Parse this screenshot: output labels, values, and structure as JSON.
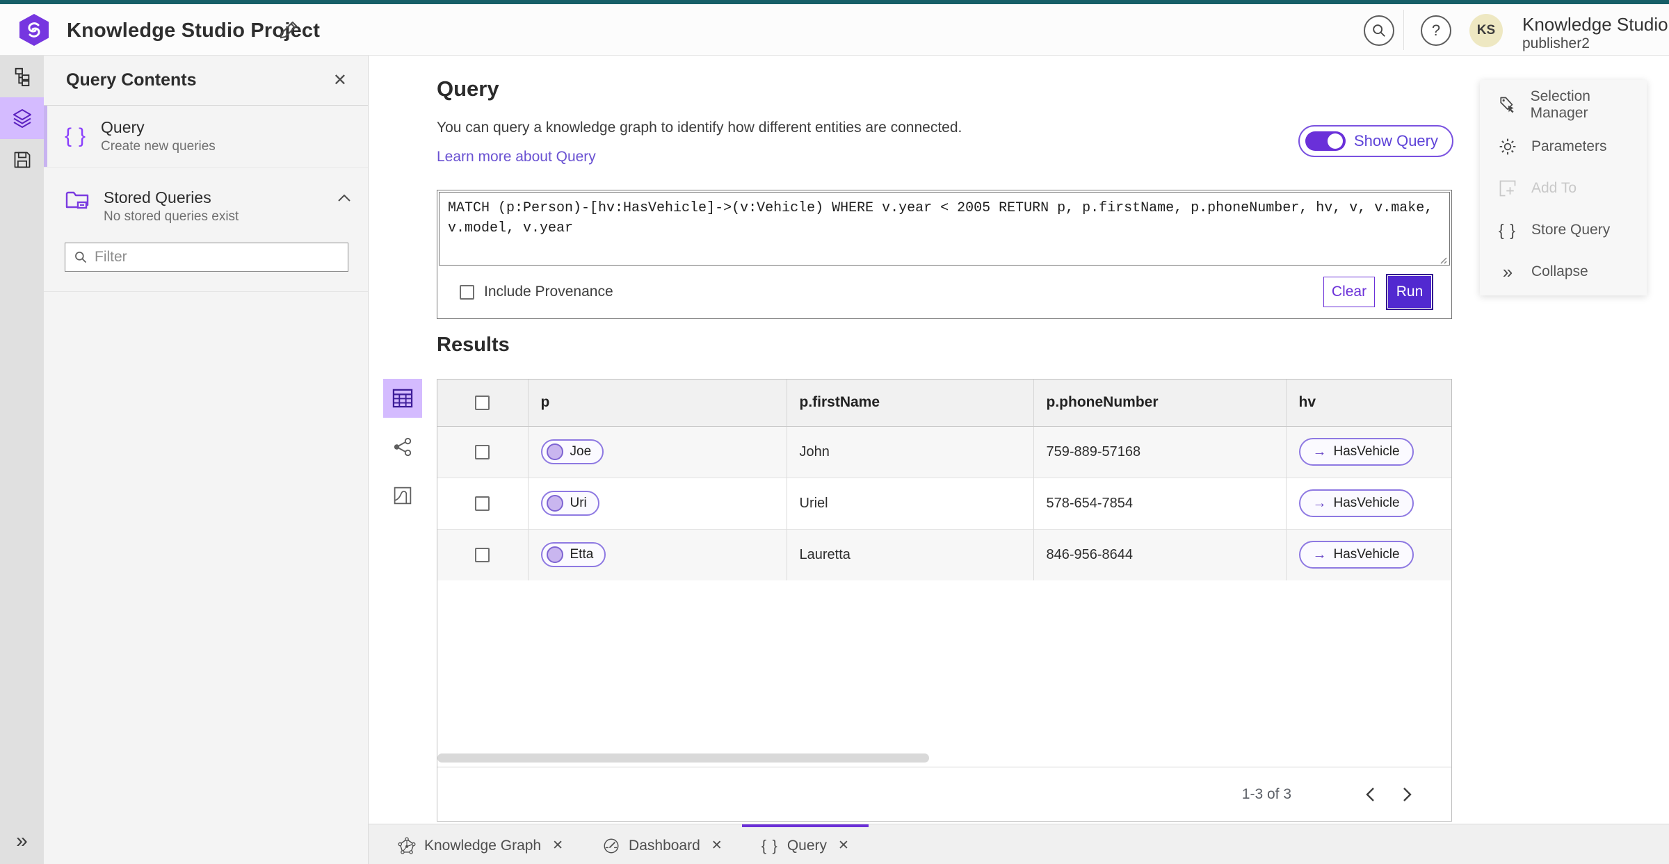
{
  "colors": {
    "top_accent_teal": "#175f68",
    "accent_purple": "#6929c4",
    "selected_lavender": "#d4bbff",
    "run_button_purple": "#5229d0",
    "avatar_bg": "#eee8c2"
  },
  "header": {
    "app_title": "Knowledge Studio Project",
    "user_initials": "KS",
    "user_org": "Knowledge Studio",
    "user_name": "publisher2"
  },
  "left_panel": {
    "title": "Query Contents",
    "query_item": {
      "title": "Query",
      "subtitle": "Create new queries"
    },
    "stored_queries": {
      "title": "Stored Queries",
      "subtitle": "No stored queries exist"
    },
    "filter_placeholder": "Filter"
  },
  "query_section": {
    "title": "Query",
    "description": "You can query a knowledge graph to identify how different entities are connected.",
    "learn_link": "Learn more about Query",
    "show_query_label": "Show Query",
    "query_text": "MATCH (p:Person)-[hv:HasVehicle]->(v:Vehicle) WHERE v.year < 2005 RETURN p, p.firstName, p.phoneNumber, hv, v, v.make, v.model, v.year",
    "include_provenance_label": "Include Provenance",
    "clear_label": "Clear",
    "run_label": "Run"
  },
  "actions_panel": {
    "items": [
      {
        "label": "Selection Manager"
      },
      {
        "label": "Parameters"
      },
      {
        "label": "Add To"
      },
      {
        "label": "Store Query"
      },
      {
        "label": "Collapse"
      }
    ]
  },
  "results": {
    "title": "Results",
    "columns": [
      "p",
      "p.firstName",
      "p.phoneNumber",
      "hv"
    ],
    "rows": [
      {
        "p": "Joe",
        "firstName": "John",
        "phone": "759-889-57168",
        "hv": "HasVehicle"
      },
      {
        "p": "Uri",
        "firstName": "Uriel",
        "phone": "578-654-7854",
        "hv": "HasVehicle"
      },
      {
        "p": "Etta",
        "firstName": "Lauretta",
        "phone": "846-956-8644",
        "hv": "HasVehicle"
      }
    ],
    "pagination": "1-3 of 3"
  },
  "tabs": [
    {
      "label": "Knowledge Graph"
    },
    {
      "label": "Dashboard"
    },
    {
      "label": "Query"
    }
  ]
}
